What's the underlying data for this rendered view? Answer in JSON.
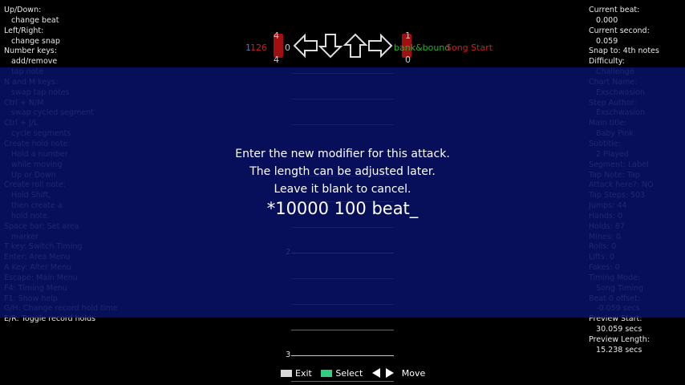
{
  "help_left": [
    "Up/Down:",
    "   change beat",
    "Left/Right:",
    "   change snap",
    "Number keys:",
    "   add/remove",
    "   tap note",
    "N and M keys:",
    "   swap tap notes",
    "Ctrl + N/M",
    "   swap cycled segment",
    "Ctrl + J/L",
    "   cycle segments",
    "Create hold note:",
    "   Hold a number",
    "   while moving",
    "   Up or Down",
    "Create roll note:",
    "   Hold Shift,",
    "   then create a",
    "   hold note.",
    "Space bar: Set area",
    "   marker",
    "T key: Switch Timing",
    "Enter: Area Menu",
    "A Key: Alter Menu",
    "Escape: Main Menu",
    "F4: Timing Menu",
    "F1: Show help",
    "G/H: Change record hold time",
    "E/R: Toggle record holds"
  ],
  "help_right": [
    "Current beat:",
    "   0.000",
    "Current second:",
    "   0.059",
    "Snap to: 4th notes",
    "Difficulty:",
    "   Challenge",
    "Chart Name:",
    "   Exschwasion",
    "Step Author:",
    "   Exschwasion",
    "Main title:",
    "   Baby Pink",
    "Subtitle:",
    "   2 Played",
    "Segment: Label",
    "Tap Note: Tap",
    "Attack here?: NO",
    "Tap Steps: 503",
    "Jumps: 44",
    "Hands: 0",
    "Holds: 87",
    "Mines: 0",
    "Rolls: 0",
    "Lifts: 0",
    "Fakes: 0",
    "Timing Mode:",
    "   Song Timing",
    "Beat 0 offset:",
    "   -0.059 secs",
    "Preview Start:",
    "   30.059 secs",
    "Preview Length:",
    "   15.238 secs"
  ],
  "notefield": {
    "left_top_num": "4",
    "left_bottom_num": "4",
    "left_zero": "0",
    "left_bpm": "126",
    "right_top_num": "1",
    "right_bottom_num": "0",
    "tag_green": "bank&bound",
    "tag_red": "Song Start",
    "beat_2": "2",
    "beat_3": "3"
  },
  "dialog": {
    "line1": "Enter the new modifier for this attack.",
    "line2": "The length can be adjusted later.",
    "line3": "Leave it blank to cancel.",
    "entry": "*10000 100 beat_"
  },
  "footer": {
    "exit": "Exit",
    "select": "Select",
    "move": "Move"
  },
  "colors": {
    "overlay": "#08126b",
    "accent_red": "#c82020",
    "accent_green": "#28b028",
    "exit_key": "#d8d8d8",
    "select_key": "#30d080"
  }
}
